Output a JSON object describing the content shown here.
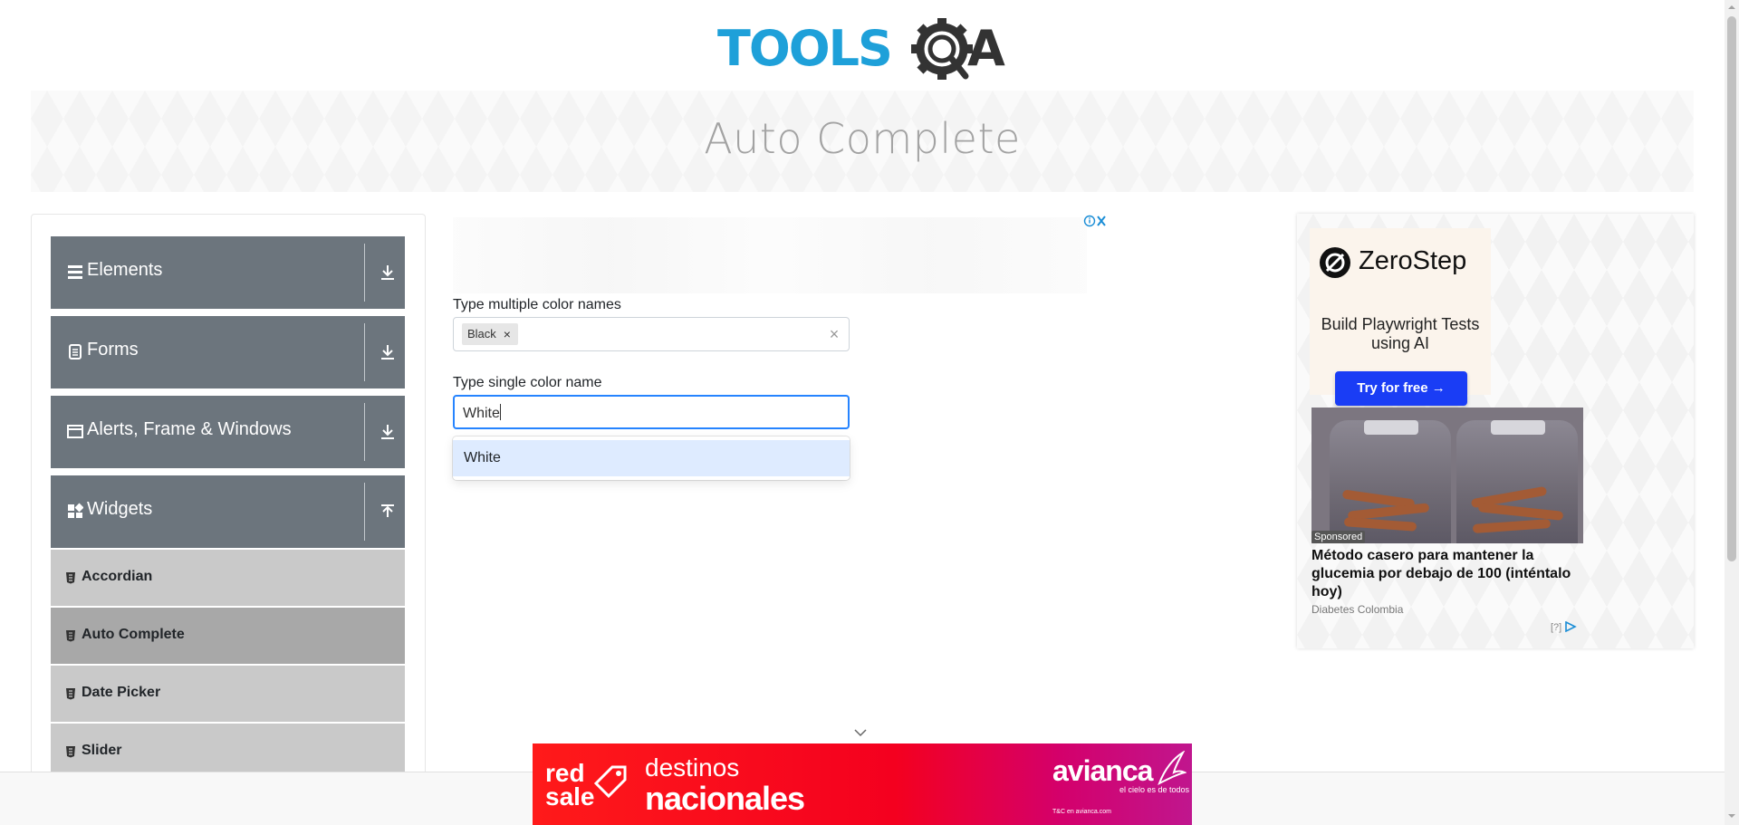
{
  "header": {
    "logo_text": "TOOLSQA"
  },
  "page": {
    "title": "Auto Complete"
  },
  "sidebar": {
    "groups": [
      {
        "label": "Elements",
        "icon": "menu-icon",
        "state": "collapsed"
      },
      {
        "label": "Forms",
        "icon": "form-icon",
        "state": "collapsed"
      },
      {
        "label": "Alerts, Frame & Windows",
        "icon": "window-icon",
        "state": "collapsed"
      },
      {
        "label": "Widgets",
        "icon": "widgets-icon",
        "state": "expanded"
      }
    ],
    "widgets_items": [
      {
        "label": "Accordian",
        "active": false
      },
      {
        "label": "Auto Complete",
        "active": true
      },
      {
        "label": "Date Picker",
        "active": false
      },
      {
        "label": "Slider",
        "active": false
      }
    ]
  },
  "form": {
    "multi": {
      "label": "Type multiple color names",
      "chips": [
        "Black"
      ],
      "chip_remove_glyph": "×",
      "clear_glyph": "×"
    },
    "single": {
      "label": "Type single color name",
      "value": "White",
      "options": [
        "White"
      ]
    }
  },
  "ads": {
    "right": {
      "brand": "ZeroStep",
      "tagline": "Build Playwright Tests using AI",
      "cta": "Try for free →",
      "sponsored": "Sponsored",
      "headline": "Método casero para mantener la glucemia por debajo de 100 (inténtalo hoy)",
      "source": "Diabetes Colombia",
      "adchoice": "[?]"
    },
    "bottom": {
      "red": "red",
      "sale": "sale",
      "line1": "destinos",
      "line2": "nacionales",
      "brand": "avianca",
      "slogan": "el cielo es de todos",
      "terms": "T&C en avianca.com"
    }
  },
  "colors": {
    "sidebar_group": "#6c757d",
    "sidebar_item": "#c9c9c9",
    "sidebar_item_active": "#a8a8a8",
    "focus_border": "#2684ff",
    "option_highlight": "#deebff",
    "logo_blue": "#1ea0d9",
    "logo_dark": "#333333",
    "cta_blue": "#1a3df5"
  }
}
